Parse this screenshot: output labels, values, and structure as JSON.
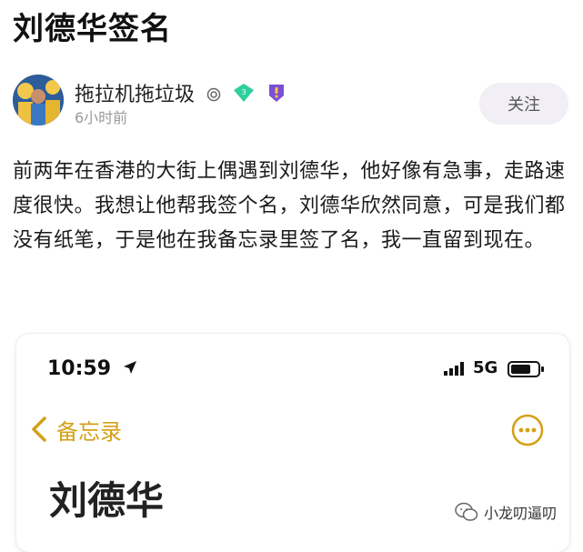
{
  "page": {
    "title": "刘德华签名"
  },
  "post": {
    "username": "拖拉机拖垃圾",
    "badge_level": "3",
    "time": "6小时前",
    "follow_label": "关注",
    "body": "前两年在香港的大街上偶遇到刘德华，他好像有急事，走路速度很快。我想让他帮我签个名，刘德华欣然同意，可是我们都没有纸笔，于是他在我备忘录里签了名，我一直留到现在。"
  },
  "phone": {
    "time": "10:59",
    "network": "5G",
    "back_label": "备忘录",
    "note_title": "刘德华"
  },
  "watermark": {
    "label": "小龙叨逼叨"
  },
  "colors": {
    "accent_gold": "#d4a017",
    "badge_green": "#2ecf9c",
    "badge_purple": "#7b4fd6"
  }
}
